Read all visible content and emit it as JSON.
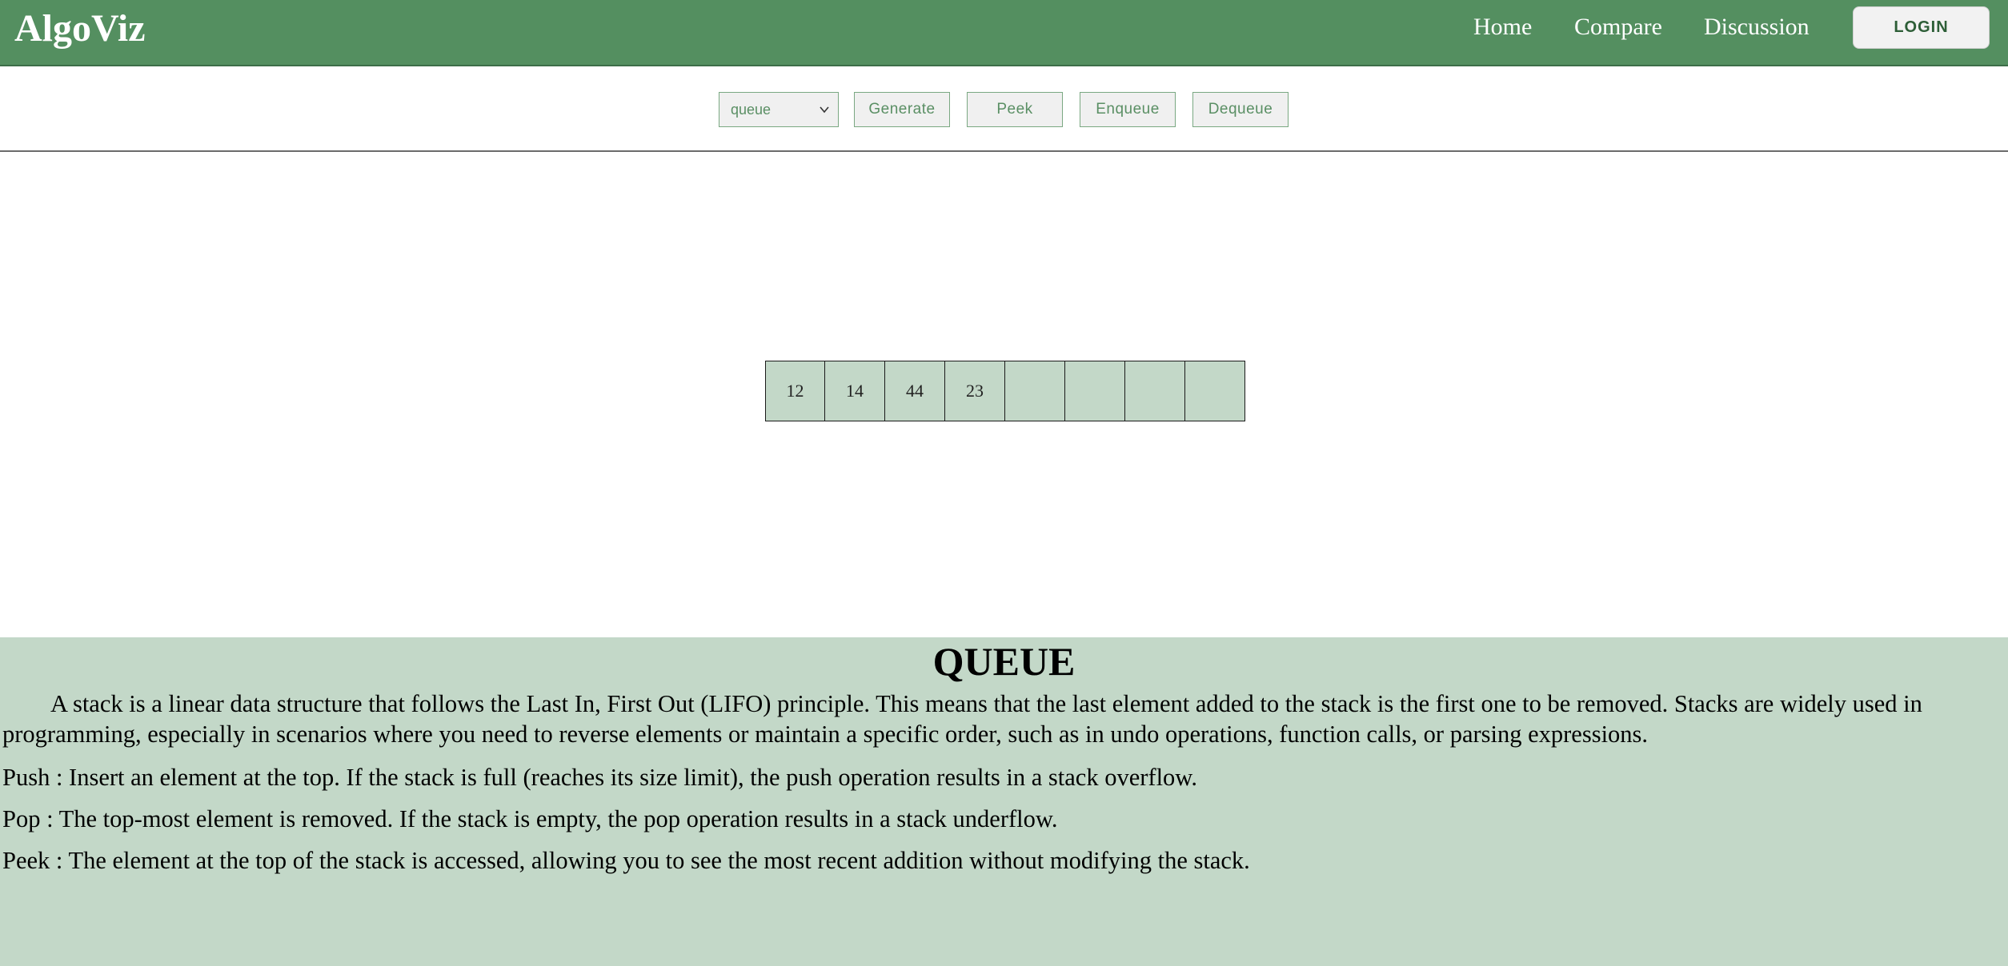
{
  "navbar": {
    "brand": "AlgoViz",
    "links": [
      "Home",
      "Compare",
      "Discussion"
    ],
    "login_label": "LOGIN",
    "color": "#548f60"
  },
  "toolbar": {
    "select_value": "queue",
    "buttons": [
      "Generate",
      "Peek",
      "Enqueue",
      "Dequeue"
    ]
  },
  "queue": {
    "cells": [
      "12",
      "14",
      "44",
      "23",
      "",
      "",
      "",
      ""
    ],
    "cell_color": "#c3d8c8"
  },
  "info": {
    "title": "QUEUE",
    "description": "A stack is a linear data structure that follows the Last In, First Out (LIFO) principle. This means that the last element added to the stack is the first one to be removed. Stacks are widely used in programming, especially in scenarios where you need to reverse elements or maintain a specific order, such as in undo operations, function calls, or parsing expressions.",
    "operations": [
      "Push : Insert an element at the top. If the stack is full (reaches its size limit), the push operation results in a stack overflow.",
      "Pop : The top-most element is removed. If the stack is empty, the pop operation results in a stack underflow.",
      "Peek : The element at the top of the stack is accessed, allowing you to see the most recent addition without modifying the stack."
    ],
    "background": "#c3d8c8"
  }
}
